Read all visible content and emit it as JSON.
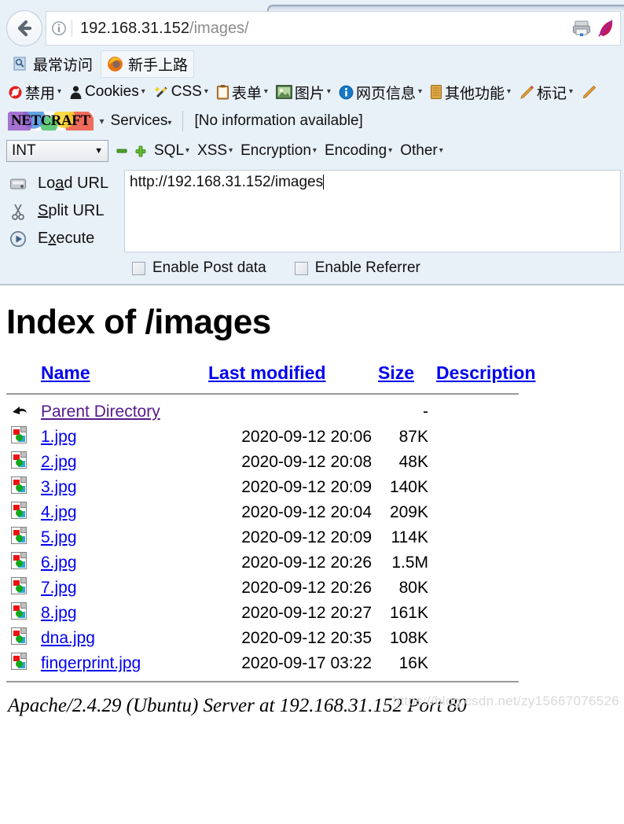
{
  "browser": {
    "back_button": "back-arrow",
    "identity_icon": "info-circle-icon",
    "url_host": "192.168.31.152",
    "url_path": "/images/",
    "toolbar_right_icons": [
      "printer-icon",
      "feather-pen-icon"
    ]
  },
  "bookmarks": [
    {
      "label": "最常访问",
      "icon": "most-visited-icon"
    },
    {
      "label": "新手上路",
      "icon": "firefox-icon"
    }
  ],
  "extension_toolbar": [
    {
      "label": "禁用",
      "icon": "disable-icon",
      "caret": "▾"
    },
    {
      "label": "Cookies",
      "icon": "cookie-person-icon",
      "caret": "▾"
    },
    {
      "label": "CSS",
      "icon": "css-wand-icon",
      "caret": "▾"
    },
    {
      "label": "表单",
      "icon": "form-clipboard-icon",
      "caret": "▾"
    },
    {
      "label": "图片",
      "icon": "image-icon",
      "caret": "▾"
    },
    {
      "label": "网页信息",
      "icon": "info-blue-icon",
      "caret": "▾"
    },
    {
      "label": "其他功能",
      "icon": "misc-orange-icon",
      "caret": "▾"
    },
    {
      "label": "标记",
      "icon": "pencil-icon",
      "caret": "▾"
    },
    {
      "label": "",
      "icon": "ruler-icon",
      "caret": ""
    }
  ],
  "netcraft": {
    "logo_text": "NETCRAFT",
    "dot": "▾",
    "services_label": "Services",
    "services_caret": "▾",
    "info_text": "[No information available]"
  },
  "hackbar": {
    "select_value": "INT",
    "select_arrow": "▼",
    "minus_icon": "minus-icon",
    "plus_icon": "plus-icon",
    "menus": [
      {
        "label": "SQL",
        "caret": "▾"
      },
      {
        "label": "XSS",
        "caret": "▾"
      },
      {
        "label": "Encryption",
        "caret": "▾"
      },
      {
        "label": "Encoding",
        "caret": "▾"
      },
      {
        "label": "Other",
        "caret": "▾"
      }
    ],
    "actions": [
      {
        "label": "Load URL",
        "accel": "a",
        "icon": "load-url-icon"
      },
      {
        "label": "Split URL",
        "accel": "S",
        "icon": "scissors-icon"
      },
      {
        "label": "Execute",
        "accel": "x",
        "icon": "execute-play-icon"
      }
    ],
    "url_value": "http://192.168.31.152/images",
    "checkboxes": [
      {
        "label": "Enable Post data",
        "checked": false
      },
      {
        "label": "Enable Referrer",
        "checked": false
      }
    ]
  },
  "page": {
    "title": "Index of /images",
    "columns": [
      "Name",
      "Last modified",
      "Size",
      "Description"
    ],
    "rows": [
      {
        "icon": "parent-directory-icon",
        "name": "Parent Directory",
        "modified": "",
        "size": "-",
        "description": "",
        "is_parent": true
      },
      {
        "icon": "image-file-icon",
        "name": "1.jpg",
        "modified": "2020-09-12 20:06",
        "size": "87K",
        "description": ""
      },
      {
        "icon": "image-file-icon",
        "name": "2.jpg",
        "modified": "2020-09-12 20:08",
        "size": "48K",
        "description": ""
      },
      {
        "icon": "image-file-icon",
        "name": "3.jpg",
        "modified": "2020-09-12 20:09",
        "size": "140K",
        "description": ""
      },
      {
        "icon": "image-file-icon",
        "name": "4.jpg",
        "modified": "2020-09-12 20:04",
        "size": "209K",
        "description": ""
      },
      {
        "icon": "image-file-icon",
        "name": "5.jpg",
        "modified": "2020-09-12 20:09",
        "size": "114K",
        "description": ""
      },
      {
        "icon": "image-file-icon",
        "name": "6.jpg",
        "modified": "2020-09-12 20:26",
        "size": "1.5M",
        "description": ""
      },
      {
        "icon": "image-file-icon",
        "name": "7.jpg",
        "modified": "2020-09-12 20:26",
        "size": "80K",
        "description": ""
      },
      {
        "icon": "image-file-icon",
        "name": "8.jpg",
        "modified": "2020-09-12 20:27",
        "size": "161K",
        "description": ""
      },
      {
        "icon": "image-file-icon",
        "name": "dna.jpg",
        "modified": "2020-09-12 20:35",
        "size": "108K",
        "description": ""
      },
      {
        "icon": "image-file-icon",
        "name": "fingerprint.jpg",
        "modified": "2020-09-17 03:22",
        "size": "16K",
        "description": ""
      }
    ],
    "footer": "Apache/2.4.29 (Ubuntu) Server at 192.168.31.152 Port 80",
    "watermark": "https://blog.csdn.net/zy15667076526"
  },
  "colors": {
    "link": "#0000ee",
    "visited_link": "#551a8b",
    "chrome_bg": "#e8f0f8",
    "page_bg": "#ffffff",
    "rule": "#9a9a9a"
  }
}
